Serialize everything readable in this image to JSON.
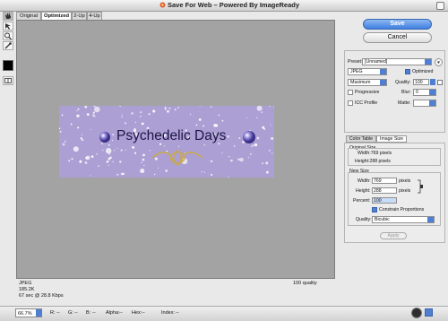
{
  "window": {
    "title": "Save For Web – Powered By ImageReady"
  },
  "tools": [
    "hand-tool-icon",
    "slice-select-tool-icon",
    "zoom-tool-icon",
    "eyedropper-tool-icon",
    "eyedropper-color-swatch",
    "toggle-slices-icon"
  ],
  "tabs": [
    {
      "label": "Original",
      "active": false
    },
    {
      "label": "Optimized",
      "active": true
    },
    {
      "label": "2-Up",
      "active": false
    },
    {
      "label": "4-Up",
      "active": false
    }
  ],
  "preview": {
    "image_text": "Psychedelic Days",
    "banner_color": "#ab9fd4"
  },
  "image_info": {
    "format": "JPEG",
    "size": "185.2K",
    "download": "67 sec @ 28.8 Kbps",
    "quality_note": "100 quality"
  },
  "status_bar": {
    "zoom": "66.7%",
    "r": "R:",
    "g": "G:",
    "b": "B:",
    "alpha": "Alpha:",
    "hex": "Hex:",
    "index": "Index:",
    "r_value": "--",
    "g_value": "--",
    "b_value": "--",
    "alpha_value": "--",
    "hex_value": "--",
    "index_value": "--"
  },
  "buttons": {
    "save": "Save",
    "cancel": "Cancel",
    "apply": "Apply"
  },
  "settings": {
    "preset_label": "Preset:",
    "preset_value": "[Unnamed]",
    "format_value": "JPEG",
    "optimized_label": "Optimized",
    "optimized_checked": true,
    "quality_setting": "Maximum",
    "quality_label": "Quality:",
    "quality_value": "100",
    "progressive_label": "Progressive",
    "progressive_checked": false,
    "blur_label": "Blur:",
    "blur_value": "0",
    "icc_label": "ICC Profile",
    "icc_checked": false,
    "matte_label": "Matte:"
  },
  "panel_tabs": [
    {
      "label": "Color Table",
      "active": false
    },
    {
      "label": "Image Size",
      "active": true
    }
  ],
  "image_size": {
    "original_title": "Original Size",
    "orig_width": "Width:769 pixels",
    "orig_height": "Height:288 pixels",
    "new_title": "New Size",
    "width_label": "Width:",
    "width_value": "769",
    "height_label": "Height:",
    "height_value": "288",
    "pixels": "pixels",
    "percent_label": "Percent:",
    "percent_value": "100",
    "constrain_label": "Constrain Proportions",
    "constrain_checked": true,
    "quality_label": "Quality:",
    "quality_value": "Bicubic"
  }
}
